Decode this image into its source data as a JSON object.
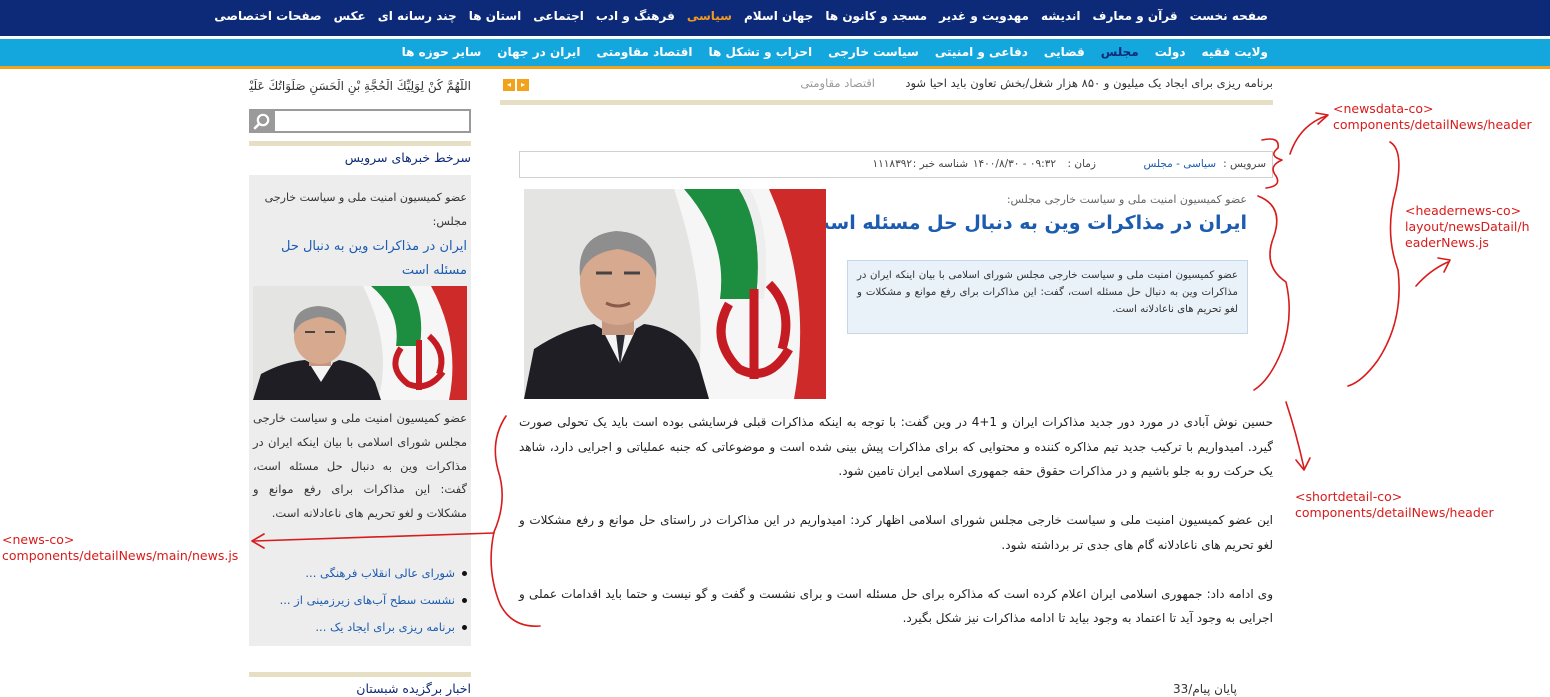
{
  "nav": {
    "primary": [
      {
        "label": "صفحه نخست",
        "active": false
      },
      {
        "label": "قرآن و معارف",
        "active": false
      },
      {
        "label": "اندیشه",
        "active": false
      },
      {
        "label": "مهدویت و غدیر",
        "active": false
      },
      {
        "label": "مسجد و کانون ها",
        "active": false
      },
      {
        "label": "جهان اسلام",
        "active": false
      },
      {
        "label": "سیاسی",
        "active": true
      },
      {
        "label": "فرهنگ و ادب",
        "active": false
      },
      {
        "label": "اجتماعی",
        "active": false
      },
      {
        "label": "استان ها",
        "active": false
      },
      {
        "label": "چند رسانه ای",
        "active": false
      },
      {
        "label": "عکس",
        "active": false
      },
      {
        "label": "صفحات اختصاصی",
        "active": false
      }
    ],
    "secondary": [
      {
        "label": "ولایت فقیه",
        "active": false
      },
      {
        "label": "دولت",
        "active": false
      },
      {
        "label": "مجلس",
        "active": true
      },
      {
        "label": "قضایی",
        "active": false
      },
      {
        "label": "دفاعی و امنیتی",
        "active": false
      },
      {
        "label": "سیاست خارجی",
        "active": false
      },
      {
        "label": "احزاب و تشکل ها",
        "active": false
      },
      {
        "label": "اقتصاد مقاومتی",
        "active": false
      },
      {
        "label": "ایران در جهان",
        "active": false
      },
      {
        "label": "سایر حوزه ها",
        "active": false
      }
    ]
  },
  "ticker": {
    "headline": "برنامه ریزی برای ایجاد یک میلیون و ۸۵۰ هزار شغل/بخش تعاون باید احیا شود",
    "category": "اقتصاد مقاومتی",
    "prev": "◂",
    "next": "▸"
  },
  "meta": {
    "service_label": "سرویس :",
    "service_value": "سیاسی - مجلس",
    "time_label": "زمان :",
    "time_value": "۰۹:۳۲ - ۱۴۰۰/۸/۳۰",
    "id_label": "شناسه خبر :",
    "id_value": "۱۱۱۸۳۹۲"
  },
  "article": {
    "lead_title": "عضو کمیسیون امنیت ملی و سیاست خارجی مجلس:",
    "headline": "ایران در مذاکرات وین به دنبال حل مسئله است",
    "summary": "عضو کمیسیون امنیت ملی و سیاست خارجی مجلس شورای اسلامی با بیان اینکه ایران در مذاکرات وین به دنبال حل مسئله است، گفت: این مذاکرات برای رفع موانع و مشکلات و لغو تحریم های ناعادلانه است.",
    "paragraphs": [
      "حسین نوش آبادی در مورد دور جدید مذاکرات ایران و 1+4 در وین گفت: با توجه به اینکه مذاکرات قبلی فرسایشی بوده است باید یک تحولی صورت گیرد. امیدواریم با ترکیب جدید تیم مذاکره کننده و محتوایی که برای مذاکرات پیش بینی شده است و موضوعاتی که جنبه عملیاتی و اجرایی دارد، شاهد یک حرکت رو به جلو باشیم و در مذاکرات حقوق حقه جمهوری اسلامی ایران تامین شود.",
      "این عضو کمیسیون امنیت ملی و سیاست خارجی مجلس شورای اسلامی اظهار کرد: امیدواریم در این مذاکرات در راستای حل موانع و رفع مشکلات و لغو تحریم های ناعادلانه گام های جدی تر برداشته شود.",
      "وی ادامه داد: جمهوری اسلامی ایران اعلام کرده است که مذاکره برای حل مسئله است و برای نشست و گفت و گو نیست و حتما باید اقدامات عملی و اجرایی به وجود آید تا اعتماد به وجود بیاید تا ادامه مذاکرات نیز شکل بگیرد."
    ],
    "end": "پایان پیام/33"
  },
  "sidebar": {
    "verse": "اللَّهُمَّ كُنْ لِوَلِيِّكَ الْحُجَّةِ بْنِ الْحَسَنِ صَلَوَاتُكَ عَلَيْهِ وَ عَلَى آبَائِهِ فِي هَذِهِ السَّاعَةِ وَ فِي كُلِّ سَاعَةٍ وَلِيّاً وَ حَافِظاً وَ قَائِداً وَ نَاصِراً وَ دَلِيلًا وَ عَيْناً، حَتَّى تُسْكِنَهُ أَ",
    "search_placeholder": "",
    "service_heading": "سرخط خبرهای سرویس",
    "lead_title": "عضو کمیسیون امنیت ملی و سیاست خارجی مجلس:",
    "headline": "ایران در مذاکرات وین به دنبال حل مسئله است",
    "summary": "عضو کمیسیون امنیت ملی و سیاست خارجی مجلس شورای اسلامی با بیان اینکه ایران در مذاکرات وین به دنبال حل مسئله است، گفت: این مذاکرات برای رفع موانع و مشکلات و لغو تحریم های ناعادلانه است.",
    "links": [
      "شورای عالی انقلاب فرهنگی ...",
      "نشست سطح آب‌های زیرزمینی از ...",
      "برنامه ریزی برای ایجاد یک ..."
    ],
    "featured_heading": "اخبار برگزیده شبستان"
  },
  "annotations": {
    "newsdata": [
      "<newsdata-co>",
      "components/detailNews/header"
    ],
    "headernews": [
      "<headernews-co>",
      "layout/newsDatail/h",
      "eaderNews.js"
    ],
    "shortdetail": [
      "<shortdetail-co>",
      "components/detailNews/header"
    ],
    "news": [
      "<news-co>",
      "components/detailNews/main/news.js"
    ]
  },
  "colors": {
    "nav_primary_bg": "#0d2a78",
    "nav_secondary_bg": "#14a7de",
    "accent_orange": "#f39a1d",
    "link_blue": "#1c5cb0",
    "annotation_red": "#d81b1b"
  }
}
